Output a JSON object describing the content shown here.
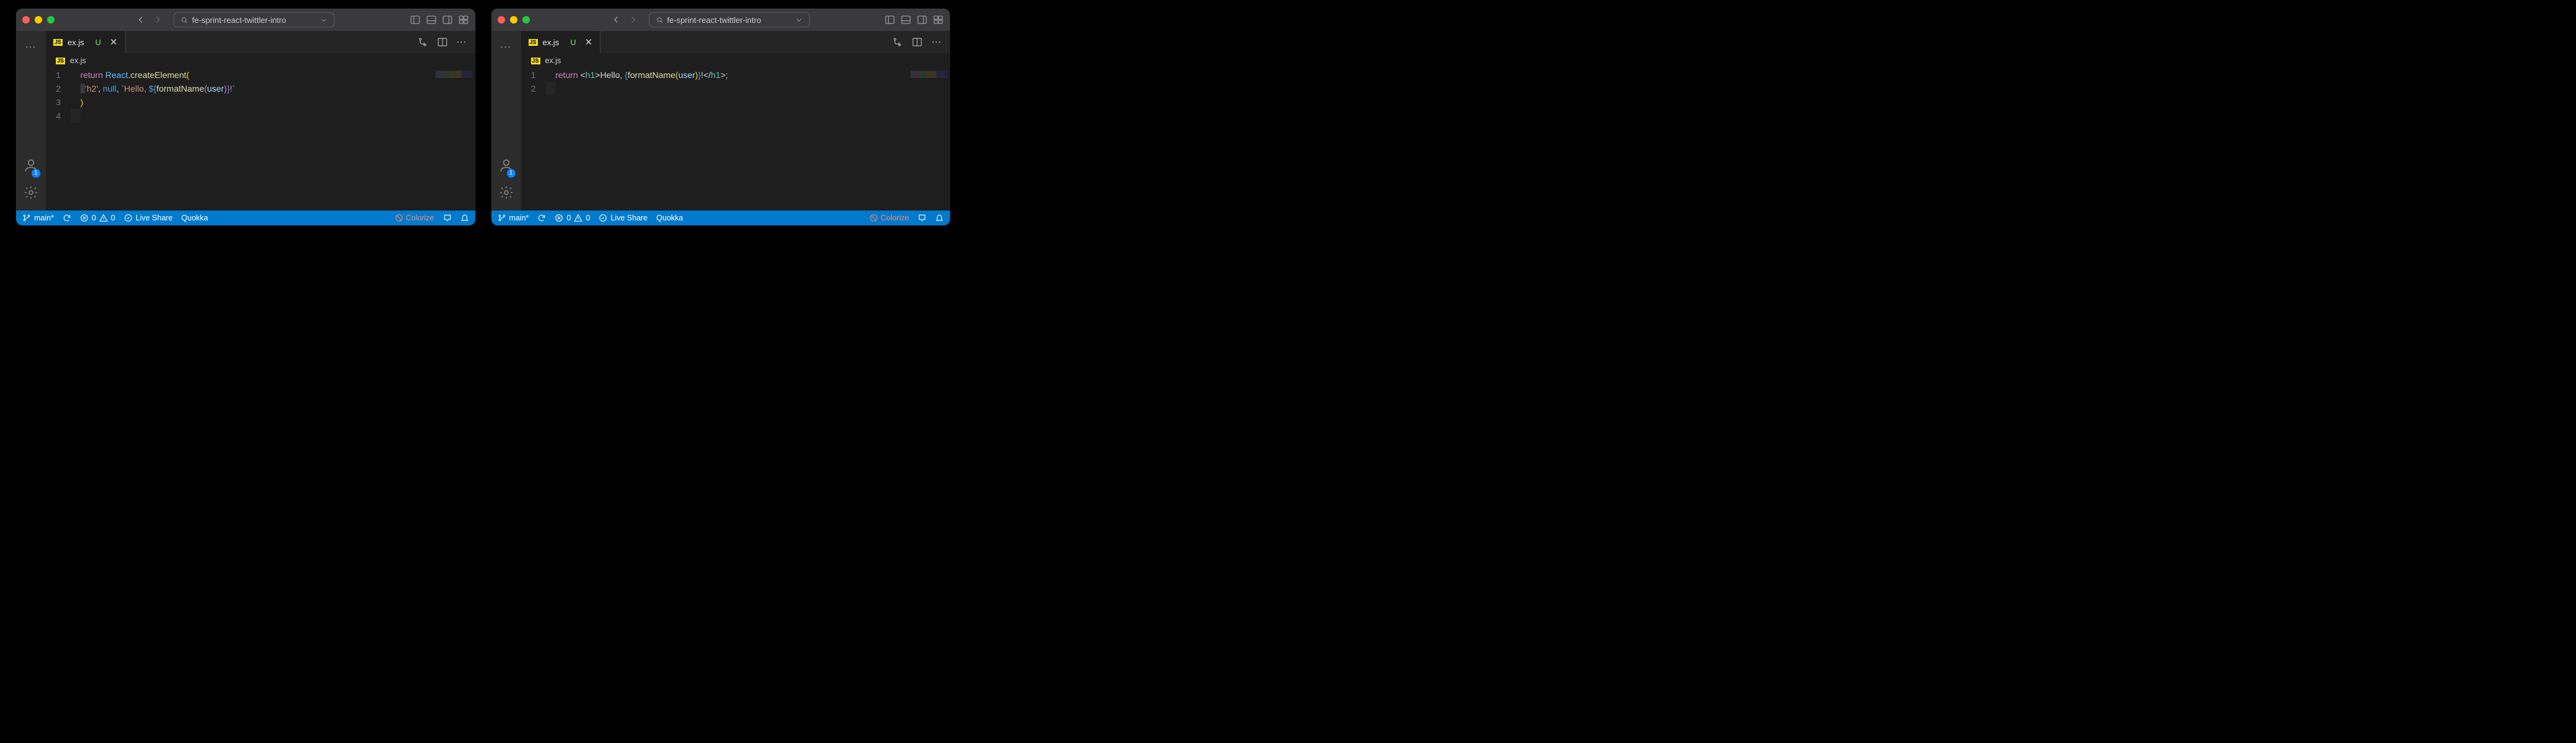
{
  "windows": [
    {
      "project": "fe-sprint-react-twittler-intro",
      "tab": {
        "file": "ex.js",
        "status": "U"
      },
      "breadcrumb": "ex.js",
      "account_badge": "1",
      "code_html": "<div class='gutter-line'><span class='ln'>1</span><span class='code'>    <span class='k'>return</span> <span class='c'>React</span><span class='p'>.</span><span class='f'>createElement</span><span class='br'>(</span></span></div><div class='gutter-line'><span class='ln'>2</span><span class='code'>    <span class='hl-box'>  </span><span class='s'>'h2'</span><span class='p'>,</span> <span class='n'>null</span><span class='p'>,</span> <span class='s'>`Hello, </span><span class='n'>${</span><span class='f'>formatName</span><span class='br2'>(</span><span class='v'>user</span><span class='br2'>)</span><span class='n'>}</span><span class='s'>!`</span></span></div><div class='gutter-line'><span class='ln'>3</span><span class='code'>    <span class='br'>)</span></span></div><div class='gutter-line cursor-line'><span class='ln'>4</span><span class='code'>    </span></div>",
      "status": {
        "branch": "main*",
        "errors": "0",
        "warnings": "0",
        "liveshare": "Live Share",
        "quokka": "Quokka",
        "colorize": "Colorize"
      }
    },
    {
      "project": "fe-sprint-react-twittler-intro",
      "tab": {
        "file": "ex.js",
        "status": "U"
      },
      "breadcrumb": "ex.js",
      "account_badge": "1",
      "code_html": "<div class='gutter-line'><span class='ln'>1</span><span class='code'>    <span class='k'>return</span> <span class='p'>&lt;</span><span class='t'>h1</span><span class='p'>&gt;</span><span class='p'>Hello, </span><span class='n'>{</span><span class='f'>formatName</span><span class='br'>(</span><span class='v'>user</span><span class='br'>)</span><span class='n'>}</span><span class='p'>!&lt;/</span><span class='t'>h1</span><span class='p'>&gt;;</span></span></div><div class='gutter-line cursor-line'><span class='ln'>2</span><span class='code'>    </span></div>",
      "status": {
        "branch": "main*",
        "errors": "0",
        "warnings": "0",
        "liveshare": "Live Share",
        "quokka": "Quokka",
        "colorize": "Colorize"
      }
    }
  ]
}
